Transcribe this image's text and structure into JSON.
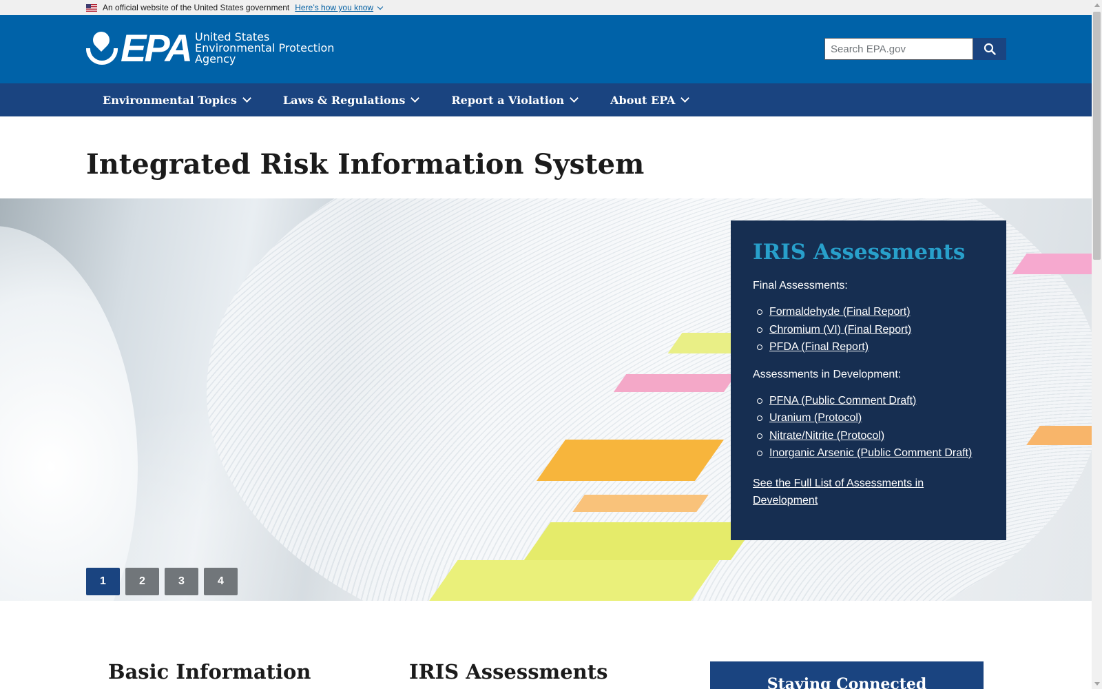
{
  "gov_banner": {
    "text": "An official website of the United States government",
    "link": "Here’s how you know"
  },
  "header": {
    "logo_text": "EPA",
    "logo_sub": [
      "United States",
      "Environmental Protection",
      "Agency"
    ],
    "search_placeholder": "Search EPA.gov",
    "search_icon": "search-icon"
  },
  "nav": {
    "items": [
      {
        "label": "Environmental Topics"
      },
      {
        "label": "Laws & Regulations"
      },
      {
        "label": "Report a Violation"
      },
      {
        "label": "About EPA"
      }
    ]
  },
  "page": {
    "title": "Integrated Risk Information System"
  },
  "hero": {
    "panel_title": "IRIS Assessments",
    "final_label": "Final Assessments:",
    "final_items": [
      "Formaldehyde (Final Report)",
      "Chromium (VI) (Final Report)",
      "PFDA (Final Report)"
    ],
    "dev_label": "Assessments in Development:",
    "dev_items": [
      "PFNA (Public Comment Draft)",
      "Uranium (Protocol)",
      "Nitrate/Nitrite (Protocol)",
      "Inorganic Arsenic (Public Comment Draft)"
    ],
    "full_list_link": "See the Full List of Assessments in Development",
    "pager": [
      "1",
      "2",
      "3",
      "4"
    ],
    "active_page": "1"
  },
  "sections": {
    "basic": "Basic Information",
    "iris": "IRIS Assessments",
    "connected": "Staying Connected"
  },
  "colors": {
    "header_blue": "#0062a8",
    "nav_navy": "#1a4480",
    "panel_navy": "#162e51",
    "panel_title": "#28a0cb"
  }
}
